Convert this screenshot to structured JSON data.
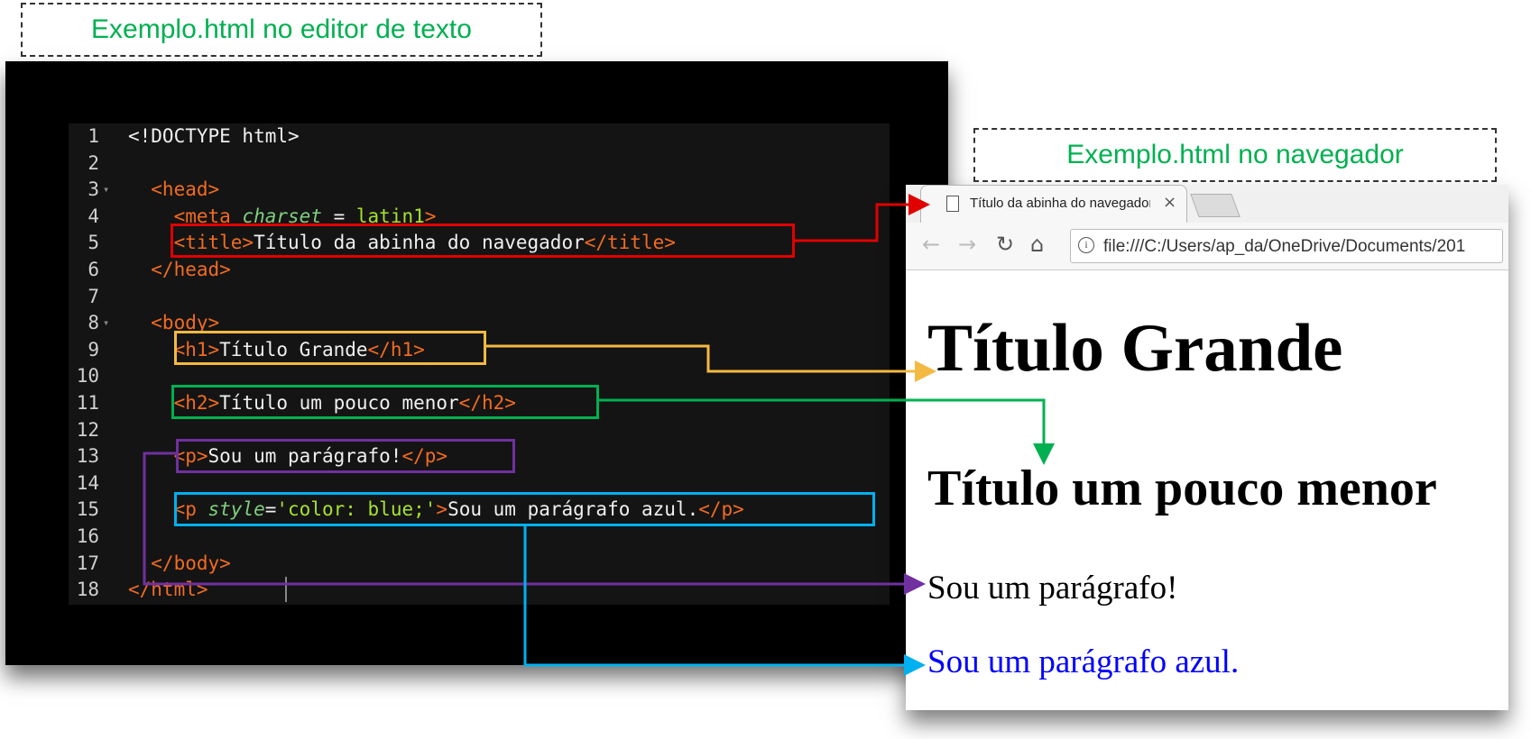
{
  "labels": {
    "editor": "Exemplo.html no editor de texto",
    "browser": "Exemplo.html no navegador"
  },
  "editor": {
    "lines": [
      {
        "n": "1",
        "parts": [
          {
            "c": "tx",
            "t": "<!DOCTYPE html>"
          }
        ]
      },
      {
        "n": "2",
        "parts": []
      },
      {
        "n": "3",
        "fold": true,
        "parts": [
          {
            "c": "tg",
            "t": "  <head>"
          }
        ]
      },
      {
        "n": "4",
        "parts": [
          {
            "c": "tg",
            "t": "    <meta "
          },
          {
            "c": "at",
            "t": "charset"
          },
          {
            "c": "eq",
            "t": " = "
          },
          {
            "c": "vl",
            "t": "latin1"
          },
          {
            "c": "tg",
            "t": ">"
          }
        ]
      },
      {
        "n": "5",
        "parts": [
          {
            "c": "tg",
            "t": "    <title>"
          },
          {
            "c": "tx",
            "t": "Título da abinha do navegador"
          },
          {
            "c": "tg",
            "t": "</title>"
          }
        ]
      },
      {
        "n": "6",
        "parts": [
          {
            "c": "tg",
            "t": "  </head>"
          }
        ]
      },
      {
        "n": "7",
        "parts": []
      },
      {
        "n": "8",
        "fold": true,
        "parts": [
          {
            "c": "tg",
            "t": "  <body>"
          }
        ]
      },
      {
        "n": "9",
        "parts": [
          {
            "c": "tg",
            "t": "    <h1>"
          },
          {
            "c": "tx",
            "t": "Título Grande"
          },
          {
            "c": "tg",
            "t": "</h1>"
          }
        ]
      },
      {
        "n": "10",
        "parts": []
      },
      {
        "n": "11",
        "parts": [
          {
            "c": "tg",
            "t": "    <h2>"
          },
          {
            "c": "tx",
            "t": "Título um pouco menor"
          },
          {
            "c": "tg",
            "t": "</h2>"
          }
        ]
      },
      {
        "n": "12",
        "parts": []
      },
      {
        "n": "13",
        "parts": [
          {
            "c": "tg",
            "t": "    <p>"
          },
          {
            "c": "tx",
            "t": "Sou um parágrafo!"
          },
          {
            "c": "tg",
            "t": "</p>"
          }
        ]
      },
      {
        "n": "14",
        "parts": []
      },
      {
        "n": "15",
        "parts": [
          {
            "c": "tg",
            "t": "    <p "
          },
          {
            "c": "at",
            "t": "style"
          },
          {
            "c": "eq",
            "t": "="
          },
          {
            "c": "vl",
            "t": "'color: blue;'"
          },
          {
            "c": "tg",
            "t": ">"
          },
          {
            "c": "tx",
            "t": "Sou um parágrafo azul."
          },
          {
            "c": "tg",
            "t": "</p>"
          }
        ]
      },
      {
        "n": "16",
        "parts": []
      },
      {
        "n": "17",
        "parts": [
          {
            "c": "tg",
            "t": "  </body>"
          }
        ]
      },
      {
        "n": "18",
        "parts": [
          {
            "c": "tg",
            "t": "</html>"
          }
        ]
      }
    ]
  },
  "browser": {
    "tab_title": "Título da abinha do navegador",
    "tab_close": "×",
    "back": "←",
    "forward": "→",
    "reload": "↻",
    "home": "⌂",
    "info": "i",
    "url": "file:///C:/Users/ap_da/OneDrive/Documents/201",
    "page": {
      "h1": "Título Grande",
      "h2": "Título um pouco menor",
      "p": "Sou um parágrafo!",
      "p_blue": "Sou um parágrafo azul."
    }
  },
  "colors": {
    "title_link": "#e00000",
    "h1_link": "#f4b942",
    "h2_link": "#00b050",
    "p_link": "#7030a0",
    "p_blue_link": "#00b0f0",
    "label_text": "#00b050",
    "page_blue": "#0000ff"
  }
}
